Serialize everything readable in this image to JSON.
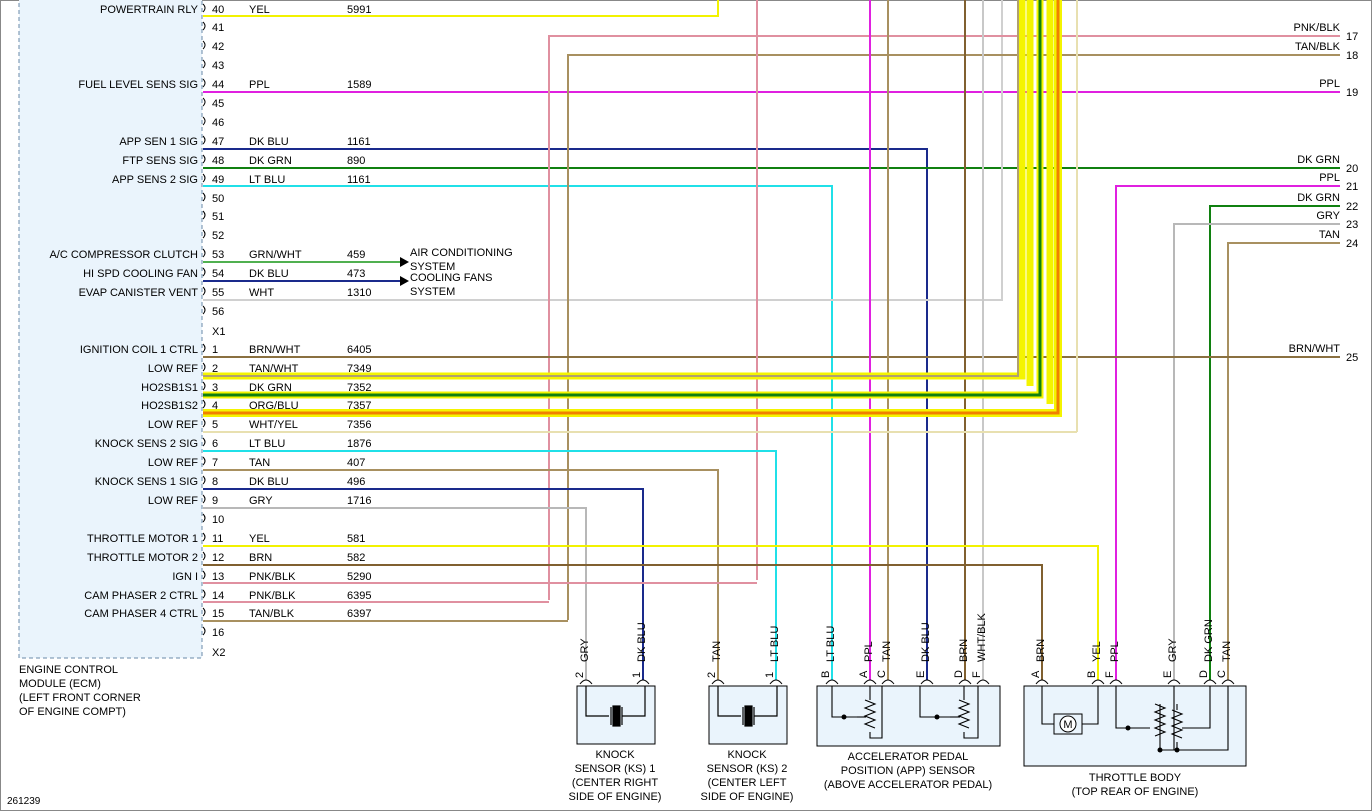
{
  "ecm": {
    "title_lines": [
      "ENGINE CONTROL",
      "MODULE (ECM)",
      "(LEFT FRONT CORNER",
      "OF ENGINE COMPT)"
    ],
    "connector_x1": "X1",
    "connector_x2": "X2",
    "figure_id": "261239"
  },
  "x1_pins": [
    {
      "pin": "40",
      "func": "POWERTRAIN RLY",
      "color_name": "YEL",
      "circuit": "5991",
      "wire": "#f2f200"
    },
    {
      "pin": "41",
      "func": "",
      "color_name": "",
      "circuit": "",
      "wire": ""
    },
    {
      "pin": "42",
      "func": "",
      "color_name": "",
      "circuit": "",
      "wire": ""
    },
    {
      "pin": "43",
      "func": "",
      "color_name": "",
      "circuit": "",
      "wire": ""
    },
    {
      "pin": "44",
      "func": "FUEL LEVEL SENS SIG",
      "color_name": "PPL",
      "circuit": "1589",
      "wire": "#e020e0"
    },
    {
      "pin": "45",
      "func": "",
      "color_name": "",
      "circuit": "",
      "wire": ""
    },
    {
      "pin": "46",
      "func": "",
      "color_name": "",
      "circuit": "",
      "wire": ""
    },
    {
      "pin": "47",
      "func": "APP SEN 1 SIG",
      "color_name": "DK BLU",
      "circuit": "1161",
      "wire": "#1a2a8c"
    },
    {
      "pin": "48",
      "func": "FTP SENS SIG",
      "color_name": "DK GRN",
      "circuit": "890",
      "wire": "#108010"
    },
    {
      "pin": "49",
      "func": "APP SENS 2 SIG",
      "color_name": "LT BLU",
      "circuit": "1161",
      "wire": "#20e0e8"
    },
    {
      "pin": "50",
      "func": "",
      "color_name": "",
      "circuit": "",
      "wire": ""
    },
    {
      "pin": "51",
      "func": "",
      "color_name": "",
      "circuit": "",
      "wire": ""
    },
    {
      "pin": "52",
      "func": "",
      "color_name": "",
      "circuit": "",
      "wire": ""
    },
    {
      "pin": "53",
      "func": "A/C COMPRESSOR CLUTCH",
      "color_name": "GRN/WHT",
      "circuit": "459",
      "wire": "#50b050"
    },
    {
      "pin": "54",
      "func": "HI SPD COOLING FAN",
      "color_name": "DK BLU",
      "circuit": "473",
      "wire": "#1a2a8c"
    },
    {
      "pin": "55",
      "func": "EVAP CANISTER VENT",
      "color_name": "WHT",
      "circuit": "1310",
      "wire": "#d0d0d0"
    },
    {
      "pin": "56",
      "func": "",
      "color_name": "",
      "circuit": "",
      "wire": ""
    }
  ],
  "x2_pins": [
    {
      "pin": "1",
      "func": "IGNITION COIL 1 CTRL",
      "color_name": "BRN/WHT",
      "circuit": "6405",
      "wire": "#8a7040"
    },
    {
      "pin": "2",
      "func": "LOW REF",
      "color_name": "TAN/WHT",
      "circuit": "7349",
      "wire": "#b0a070"
    },
    {
      "pin": "3",
      "func": "HO2SB1S1",
      "color_name": "DK GRN",
      "circuit": "7352",
      "wire": "#108010"
    },
    {
      "pin": "4",
      "func": "HO2SB1S2",
      "color_name": "ORG/BLU",
      "circuit": "7357",
      "wire": "#f08000"
    },
    {
      "pin": "5",
      "func": "LOW REF",
      "color_name": "WHT/YEL",
      "circuit": "7356",
      "wire": "#f4f400"
    },
    {
      "pin": "6",
      "func": "KNOCK SENS 2 SIG",
      "color_name": "LT BLU",
      "circuit": "1876",
      "wire": "#20e0e8"
    },
    {
      "pin": "7",
      "func": "LOW REF",
      "color_name": "TAN",
      "circuit": "407",
      "wire": "#a89060"
    },
    {
      "pin": "8",
      "func": "KNOCK SENS 1 SIG",
      "color_name": "DK BLU",
      "circuit": "496",
      "wire": "#1a2a8c"
    },
    {
      "pin": "9",
      "func": "LOW REF",
      "color_name": "GRY",
      "circuit": "1716",
      "wire": "#b8b8b8"
    },
    {
      "pin": "10",
      "func": "",
      "color_name": "",
      "circuit": "",
      "wire": ""
    },
    {
      "pin": "11",
      "func": "THROTTLE MOTOR 1",
      "color_name": "YEL",
      "circuit": "581",
      "wire": "#f2f200"
    },
    {
      "pin": "12",
      "func": "THROTTLE MOTOR 2",
      "color_name": "BRN",
      "circuit": "582",
      "wire": "#806030"
    },
    {
      "pin": "13",
      "func": "IGN I",
      "color_name": "PNK/BLK",
      "circuit": "5290",
      "wire": "#e090a0"
    },
    {
      "pin": "14",
      "func": "CAM PHASER 2 CTRL",
      "color_name": "PNK/BLK",
      "circuit": "6395",
      "wire": "#e090a0"
    },
    {
      "pin": "15",
      "func": "CAM PHASER 4 CTRL",
      "color_name": "TAN/BLK",
      "circuit": "6397",
      "wire": "#a89060"
    },
    {
      "pin": "16",
      "func": "",
      "color_name": "",
      "circuit": "",
      "wire": ""
    }
  ],
  "systems": {
    "ac": [
      "AIR CONDITIONING",
      "SYSTEM"
    ],
    "fans": [
      "COOLING FANS",
      "SYSTEM"
    ]
  },
  "right_edge": [
    {
      "label": "PNK/BLK",
      "num": "17"
    },
    {
      "label": "TAN/BLK",
      "num": "18"
    },
    {
      "label": "PPL",
      "num": "19"
    },
    {
      "label": "DK GRN",
      "num": "20"
    },
    {
      "label": "PPL",
      "num": "21"
    },
    {
      "label": "DK GRN",
      "num": "22"
    },
    {
      "label": "GRY",
      "num": "23"
    },
    {
      "label": "TAN",
      "num": "24"
    },
    {
      "label": "BRN/WHT",
      "num": "25"
    }
  ],
  "ks1": {
    "pins": [
      {
        "num": "2",
        "color": "GRY"
      },
      {
        "num": "1",
        "color": "DK BLU"
      }
    ],
    "caption": [
      "KNOCK",
      "SENSOR (KS) 1",
      "(CENTER RIGHT",
      "SIDE OF ENGINE)"
    ]
  },
  "ks2": {
    "pins": [
      {
        "num": "2",
        "color": "TAN"
      },
      {
        "num": "1",
        "color": "LT BLU"
      }
    ],
    "caption": [
      "KNOCK",
      "SENSOR (KS) 2",
      "(CENTER LEFT",
      "SIDE OF ENGINE)"
    ]
  },
  "app": {
    "pins": [
      {
        "num": "B",
        "color": "LT BLU"
      },
      {
        "num": "A",
        "color": "PPL"
      },
      {
        "num": "C",
        "color": "TAN"
      },
      {
        "num": "E",
        "color": "DK BLU"
      },
      {
        "num": "D",
        "color": "BRN"
      },
      {
        "num": "F",
        "color": "WHT/BLK"
      }
    ],
    "caption": [
      "ACCELERATOR PEDAL",
      "POSITION (APP) SENSOR",
      "(ABOVE ACCELERATOR PEDAL)"
    ]
  },
  "throttle": {
    "pins": [
      {
        "num": "A",
        "color": "BRN"
      },
      {
        "num": "B",
        "color": "YEL"
      },
      {
        "num": "F",
        "color": "PPL"
      },
      {
        "num": "E",
        "color": "GRY"
      },
      {
        "num": "D",
        "color": "DK GRN"
      },
      {
        "num": "C",
        "color": "TAN"
      }
    ],
    "motor_label": "M",
    "caption": [
      "THROTTLE BODY",
      "(TOP REAR OF ENGINE)"
    ]
  },
  "colors": {
    "ecm_fill": "#eaf4fc",
    "connector_fill": "#eaf4fc"
  }
}
